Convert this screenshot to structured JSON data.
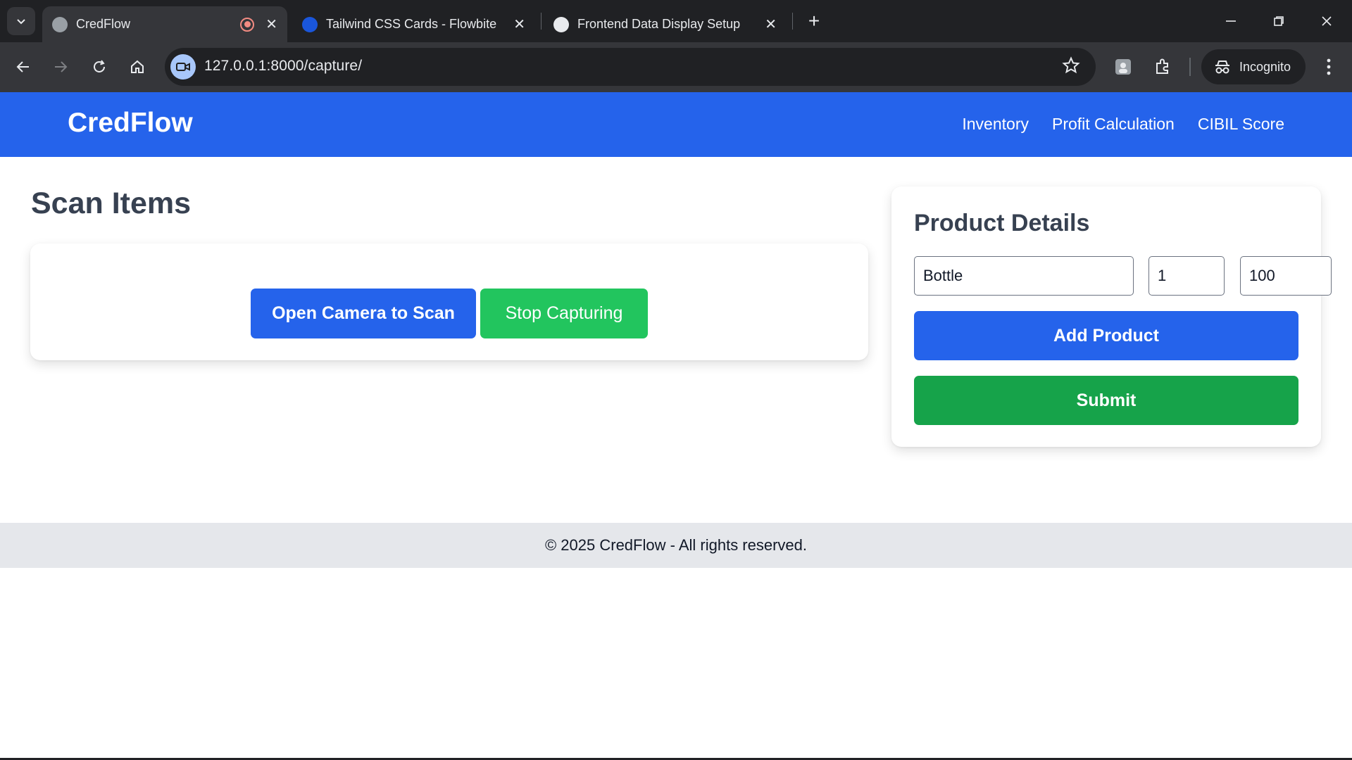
{
  "browser": {
    "tabs": [
      {
        "title": "CredFlow",
        "active": true
      },
      {
        "title": "Tailwind CSS Cards - Flowbite",
        "active": false
      },
      {
        "title": "Frontend Data Display Setup",
        "active": false
      }
    ],
    "url": "127.0.0.1:8000/capture/",
    "incognito_label": "Incognito"
  },
  "navbar": {
    "brand": "CredFlow",
    "links": [
      "Inventory",
      "Profit Calculation",
      "CIBIL Score"
    ]
  },
  "scan": {
    "title": "Scan Items",
    "open_camera_label": "Open Camera to Scan",
    "stop_label": "Stop Capturing"
  },
  "product": {
    "title": "Product Details",
    "name_value": "Bottle",
    "quantity_value": "1",
    "price_value": "100",
    "add_label": "Add Product",
    "submit_label": "Submit"
  },
  "footer": {
    "text": "© 2025 CredFlow - All rights reserved."
  },
  "colors": {
    "primary": "#2563eb",
    "success": "#22c55e",
    "success_dark": "#16a34a",
    "heading": "#374151"
  }
}
